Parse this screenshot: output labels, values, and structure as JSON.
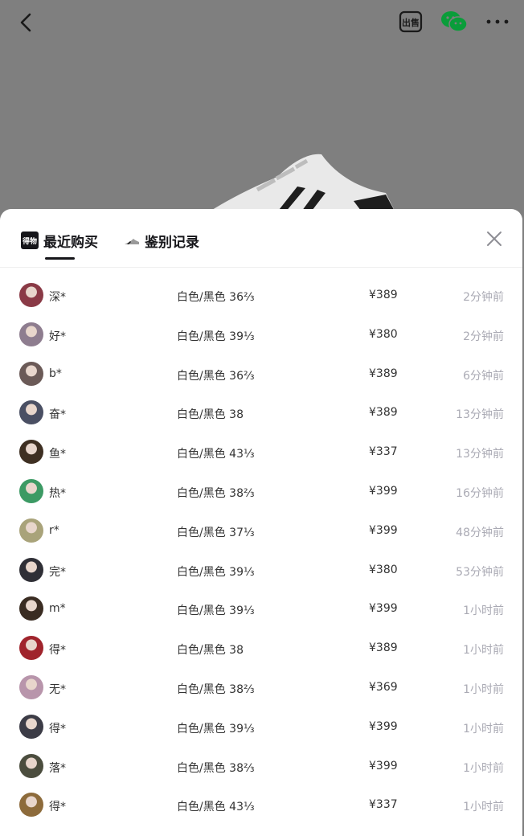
{
  "header": {
    "back_icon": "chevron-left-icon",
    "sell_icon": "sell-badge-icon",
    "sell_icon_text": "出售",
    "share_icon": "wechat-icon",
    "more_icon": "more-dots-icon"
  },
  "tabs": [
    {
      "label": "最近购买",
      "logo_text": "得物",
      "active": true
    },
    {
      "label": "鉴别记录",
      "active": false
    }
  ],
  "colors": {
    "accent": "#16161a",
    "muted": "#aaaab4",
    "text": "#333333"
  },
  "records": [
    {
      "user": "深*",
      "spec": "白色/黑色 36⅔",
      "price": "¥389",
      "time": "2分钟前",
      "avatar_color": "#8a3a46"
    },
    {
      "user": "好*",
      "spec": "白色/黑色 39⅓",
      "price": "¥380",
      "time": "2分钟前",
      "avatar_color": "#8e7d8f"
    },
    {
      "user": "b*",
      "spec": "白色/黑色 36⅔",
      "price": "¥389",
      "time": "6分钟前",
      "avatar_color": "#6b5a57"
    },
    {
      "user": "奋*",
      "spec": "白色/黑色 38",
      "price": "¥389",
      "time": "13分钟前",
      "avatar_color": "#4a4f63"
    },
    {
      "user": "鱼*",
      "spec": "白色/黑色 43⅓",
      "price": "¥337",
      "time": "13分钟前",
      "avatar_color": "#3e2f22"
    },
    {
      "user": "热*",
      "spec": "白色/黑色 38⅔",
      "price": "¥399",
      "time": "16分钟前",
      "avatar_color": "#3c9a64"
    },
    {
      "user": "r*",
      "spec": "白色/黑色 37⅓",
      "price": "¥399",
      "time": "48分钟前",
      "avatar_color": "#a9a37a"
    },
    {
      "user": "完*",
      "spec": "白色/黑色 39⅓",
      "price": "¥380",
      "time": "53分钟前",
      "avatar_color": "#2f2f36"
    },
    {
      "user": "m*",
      "spec": "白色/黑色 39⅓",
      "price": "¥399",
      "time": "1小时前",
      "avatar_color": "#3a2c22"
    },
    {
      "user": "得*",
      "spec": "白色/黑色 38",
      "price": "¥389",
      "time": "1小时前",
      "avatar_color": "#a0242c"
    },
    {
      "user": "无*",
      "spec": "白色/黑色 38⅔",
      "price": "¥369",
      "time": "1小时前",
      "avatar_color": "#b895ab"
    },
    {
      "user": "得*",
      "spec": "白色/黑色 39⅓",
      "price": "¥399",
      "time": "1小时前",
      "avatar_color": "#3c3c46"
    },
    {
      "user": "落*",
      "spec": "白色/黑色 38⅔",
      "price": "¥399",
      "time": "1小时前",
      "avatar_color": "#4b4d3e"
    },
    {
      "user": "得*",
      "spec": "白色/黑色 43⅓",
      "price": "¥337",
      "time": "1小时前",
      "avatar_color": "#8d6b3b"
    }
  ]
}
